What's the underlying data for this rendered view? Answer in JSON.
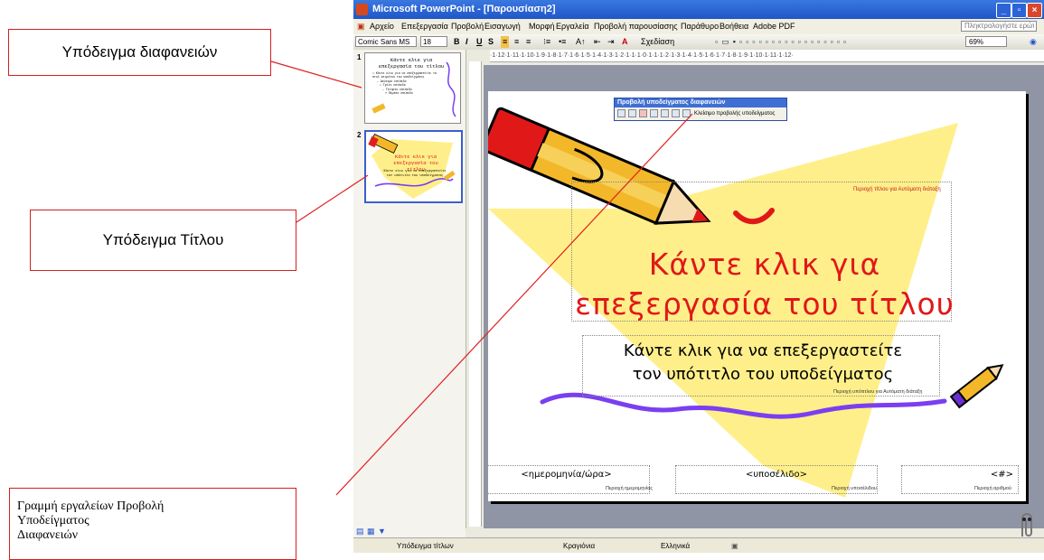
{
  "callouts": {
    "slide_master": "Υπόδειγμα διαφανειών",
    "title_master": "Υπόδειγμα Τίτλου",
    "toolbar_lines": [
      "Γραμμή εργαλείων Προβολή",
      "Υποδείγματος",
      "Διαφανειών"
    ]
  },
  "window": {
    "title": "Microsoft PowerPoint - [Παρουσίαση2]"
  },
  "menu": {
    "items": [
      "Αρχείο",
      "Επεξεργασία",
      "Προβολή",
      "Εισαγωγή",
      "Μορφή",
      "Εργαλεία",
      "Προβολή παρουσίασης",
      "Παράθυρο",
      "Βοήθεια",
      "Adobe PDF"
    ],
    "help_placeholder": "Πληκτρολογήστε ερώτηση"
  },
  "toolbar": {
    "font_name": "Comic Sans MS",
    "font_size": "18",
    "bold": "B",
    "italic": "I",
    "underline": "U",
    "shadow": "S",
    "design": "Σχεδίαση",
    "zoom": "69%"
  },
  "ruler": {
    "text": "·1·12·1·11·1·10·1·9·1·8·1·7·1·6·1·5·1·4·1·3·1·2·1·1·1·0·1·1·1·2·1·3·1·4·1·5·1·6·1·7·1·8·1·9·1·10·1·11·1·12·"
  },
  "thumbnails": [
    {
      "num": "1",
      "title": "Κάντε κλικ για επεξεργασία του τίτλου",
      "lines": [
        "• Κάντε κλικ για να επεξεργαστείτε τα στυλ κειμένου του υποδείγματος",
        "– Δεύτερο επίπεδο",
        "• Τρίτο επίπεδο",
        "– Τέταρτο επίπεδο",
        "» Πέμπτο επίπεδο"
      ]
    },
    {
      "num": "2",
      "title": "Κάντε κλικ για επεξεργασία του τίτλου",
      "subtitle": "Κάντε κλικ για να επεξεργαστείτε τον υπότιτλο του υποδείγματος"
    }
  ],
  "floating_toolbar": {
    "title": "Προβολή υποδείγματος διαφανειών",
    "close_label": "Κλείσιμο προβολής υποδείγματος"
  },
  "slide": {
    "title_area_label": "Περιοχή τίτλου για Αυτόματη διάταξη",
    "title_line1": "Κάντε κλικ για",
    "title_line2": "επεξεργασία του τίτλου",
    "subtitle_line1": "Κάντε κλικ για να επεξεργαστείτε",
    "subtitle_line2": "τον υπότιτλο του υποδείγματος",
    "subtitle_area_label": "Περιοχή υπότιτλου για Αυτόματη διάταξη",
    "date_placeholder": "<ημερομηνία/ώρα>",
    "date_label": "Περιοχή ημερομηνίας",
    "footer_placeholder": "<υποσέλιδο>",
    "footer_label": "Περιοχή υποσέλιδου",
    "number_placeholder": "<#>",
    "number_label": "Περιοχή αριθμού"
  },
  "status": {
    "view": "Υπόδειγμα τίτλων",
    "design": "Κραγιόνια",
    "language": "Ελληνικά"
  },
  "colors": {
    "accent_red": "#e01818",
    "yellow_shape": "#ffef8a",
    "purple_line": "#7a3ff0",
    "xp_blue": "#2c64d8"
  }
}
